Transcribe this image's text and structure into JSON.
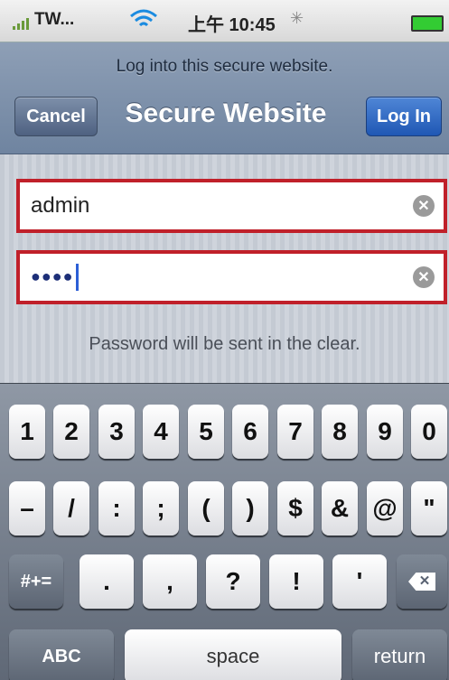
{
  "status_bar": {
    "carrier": "TW...",
    "time": "上午 10:45"
  },
  "header": {
    "prompt": "Log into this secure website.",
    "title": "Secure Website",
    "cancel_label": "Cancel",
    "login_label": "Log In"
  },
  "form": {
    "username_value": "admin",
    "password_value": "●●●●",
    "note": "Password will be sent in the clear."
  },
  "keyboard": {
    "row1": [
      "1",
      "2",
      "3",
      "4",
      "5",
      "6",
      "7",
      "8",
      "9",
      "0"
    ],
    "row2": [
      "–",
      "/",
      ":",
      ";",
      "(",
      ")",
      "$",
      "&",
      "@",
      "\""
    ],
    "row3_symbols_label": "#+=",
    "row3": [
      ".",
      ",",
      "?",
      "!",
      "'"
    ],
    "abc_label": "ABC",
    "space_label": "space",
    "return_label": "return",
    "delete_icon": "backspace-icon"
  }
}
